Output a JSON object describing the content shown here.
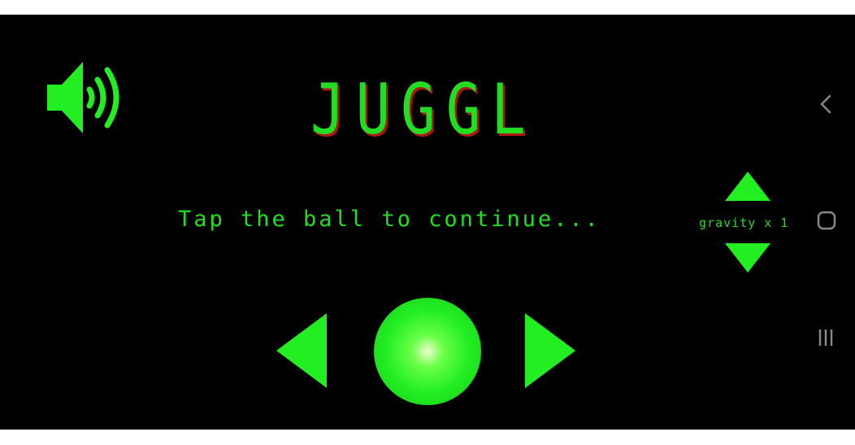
{
  "game": {
    "title": "JUGGL",
    "hint": "Tap the ball to continue...",
    "gravity_label": "gravity x 1",
    "colors": {
      "primary": "#22dd22",
      "shadow": "#b01818",
      "background": "#000000",
      "nav": "#888888"
    }
  },
  "controls": {
    "sound_icon": "speaker-on-icon",
    "gravity_up_icon": "triangle-up-icon",
    "gravity_down_icon": "triangle-down-icon",
    "left_icon": "triangle-left-icon",
    "right_icon": "triangle-right-icon"
  },
  "system_nav": {
    "back_icon": "chevron-left-icon",
    "home_icon": "rounded-square-icon",
    "recent_icon": "three-lines-icon"
  }
}
